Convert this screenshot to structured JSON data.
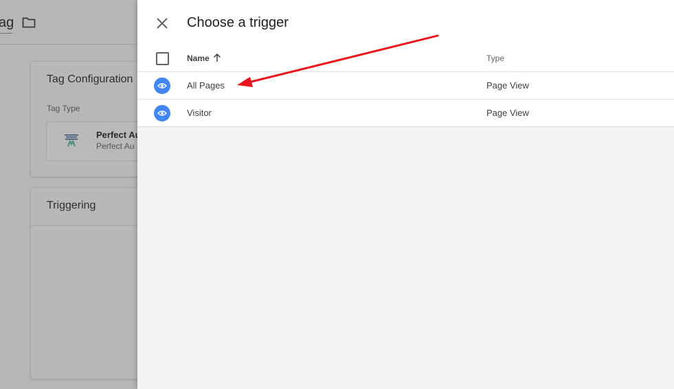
{
  "background": {
    "title_fragment": "ag",
    "tag_config": {
      "title": "Tag Configuration",
      "tag_type_label": "Tag Type",
      "tag_type_name": "Perfect Au",
      "tag_type_desc": "Perfect Au"
    },
    "triggering": {
      "title": "Triggering"
    }
  },
  "panel": {
    "title": "Choose a trigger",
    "columns": {
      "name": "Name",
      "type": "Type"
    },
    "rows": [
      {
        "name": "All Pages",
        "type": "Page View",
        "icon": "eye-icon"
      },
      {
        "name": "Visitor",
        "type": "Page View",
        "icon": "eye-icon"
      }
    ]
  },
  "colors": {
    "accent": "#4285f4",
    "annotation_arrow": "#e8151b",
    "panel_bg": "#f1f3f4",
    "overlay_bg": "#b6b6b6"
  }
}
